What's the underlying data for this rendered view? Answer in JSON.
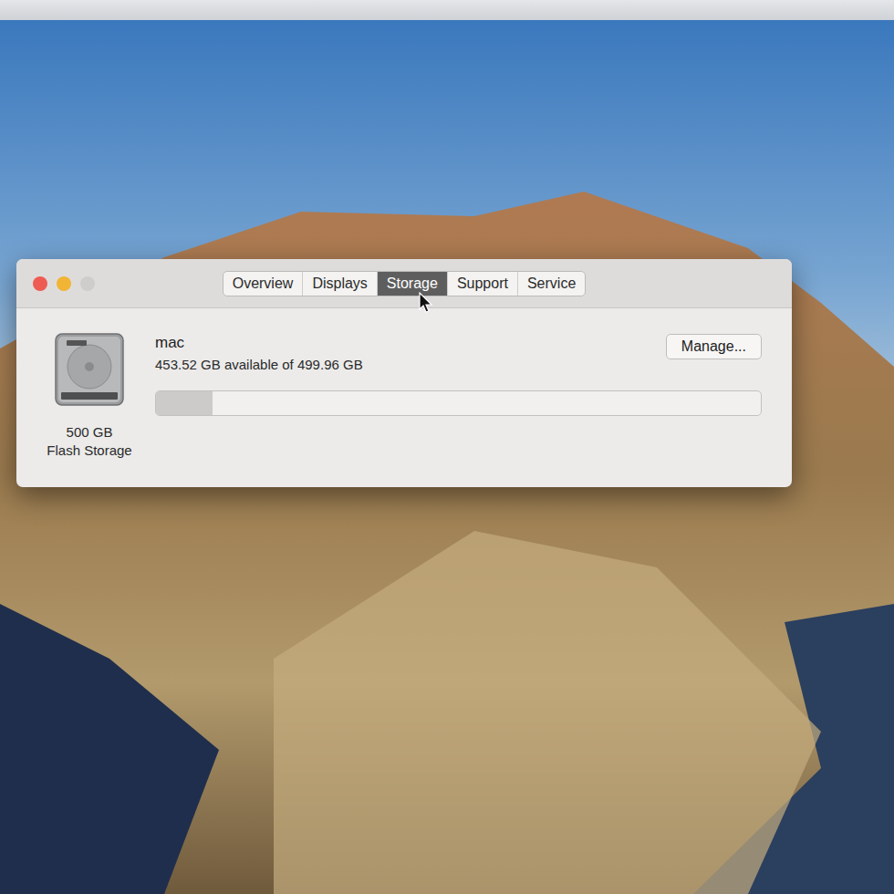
{
  "tabs": [
    {
      "label": "Overview",
      "selected": false
    },
    {
      "label": "Displays",
      "selected": false
    },
    {
      "label": "Storage",
      "selected": true
    },
    {
      "label": "Support",
      "selected": false
    },
    {
      "label": "Service",
      "selected": false
    }
  ],
  "disk": {
    "name": "mac",
    "summary": "453.52 GB available of 499.96 GB",
    "level": 0.093,
    "capacity": "500 GB",
    "type": "Flash Storage"
  },
  "buttons": [
    "Manage..."
  ]
}
